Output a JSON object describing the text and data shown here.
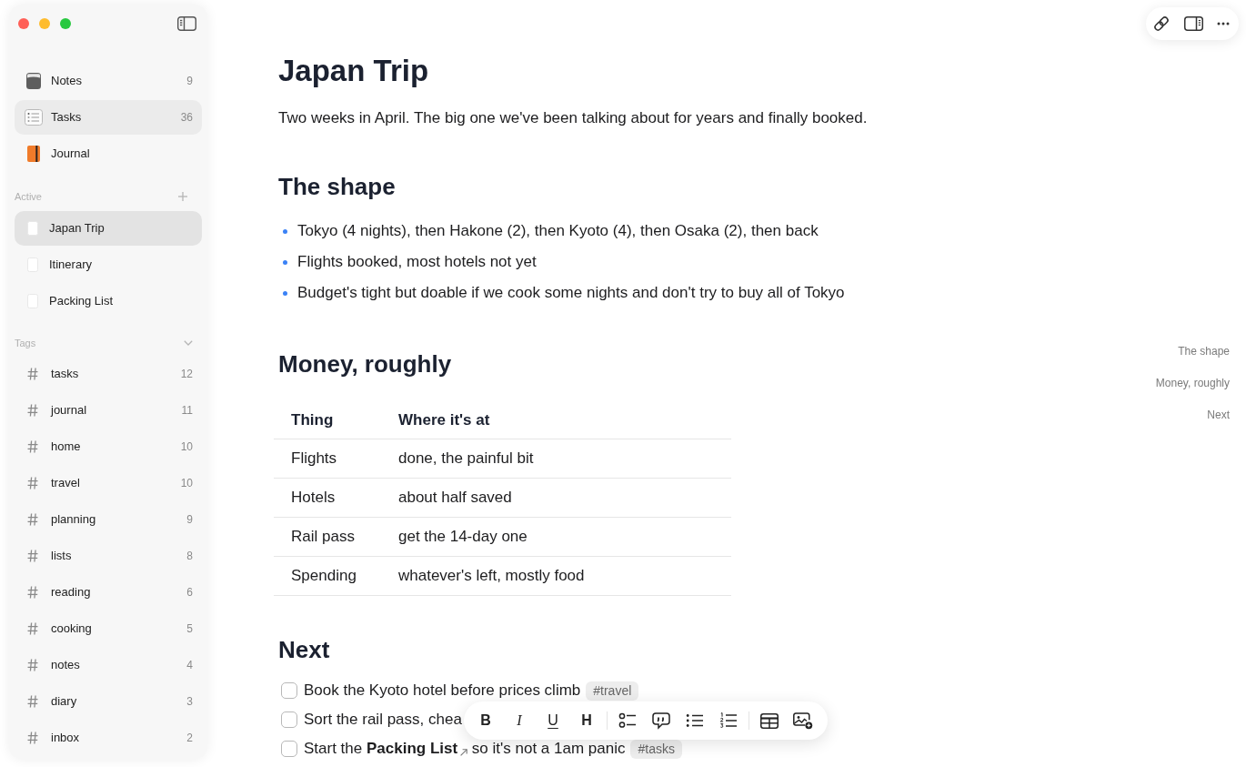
{
  "sidebar": {
    "libraries": [
      {
        "kind": "notes",
        "label": "Notes",
        "count": "9",
        "selected": false
      },
      {
        "kind": "tasks",
        "label": "Tasks",
        "count": "36",
        "selected": true
      },
      {
        "kind": "journal",
        "label": "Journal",
        "selected": false
      }
    ],
    "active": {
      "title": "Active",
      "items": [
        {
          "label": "Japan Trip",
          "selected": true
        },
        {
          "label": "Itinerary",
          "selected": false
        },
        {
          "label": "Packing List",
          "selected": false
        }
      ]
    },
    "tags": {
      "title": "Tags",
      "expanded": true,
      "items": [
        {
          "label": "tasks",
          "count": "12"
        },
        {
          "label": "journal",
          "count": "11"
        },
        {
          "label": "home",
          "count": "10"
        },
        {
          "label": "travel",
          "count": "10"
        },
        {
          "label": "planning",
          "count": "9"
        },
        {
          "label": "lists",
          "count": "8"
        },
        {
          "label": "reading",
          "count": "6"
        },
        {
          "label": "cooking",
          "count": "5"
        },
        {
          "label": "notes",
          "count": "4"
        },
        {
          "label": "diary",
          "count": "3"
        },
        {
          "label": "inbox",
          "count": "2"
        }
      ]
    }
  },
  "document": {
    "title": "Japan Trip",
    "blocks": [
      {
        "kind": "paragraph",
        "text": "Two weeks in April. The big one we've been talking about for years and finally booked."
      },
      {
        "kind": "heading",
        "text": "The shape"
      },
      {
        "kind": "bullets",
        "items": [
          "Tokyo (4 nights), then Hakone (2), then Kyoto (4), then Osaka (2), then back",
          "Flights booked, most hotels not yet",
          "Budget's tight but doable if we cook some nights and don't try to buy all of Tokyo"
        ]
      },
      {
        "kind": "heading",
        "text": "Money, roughly"
      },
      {
        "kind": "table",
        "columns": [
          "Thing",
          "Where it's at"
        ],
        "rows": [
          [
            "Flights",
            "done, the painful bit"
          ],
          [
            "Hotels",
            "about half saved"
          ],
          [
            "Rail pass",
            "get the 14-day one"
          ],
          [
            "Spending",
            "whatever's left, mostly food"
          ]
        ]
      },
      {
        "kind": "heading",
        "text": "Next"
      },
      {
        "kind": "tasks",
        "items": [
          {
            "checked": false,
            "segments": [
              {
                "kind": "text",
                "text": "Book the Kyoto hotel before prices climb"
              }
            ],
            "tag": "#travel"
          },
          {
            "checked": false,
            "segments": [
              {
                "kind": "text",
                "text": "Sort the rail pass, chea"
              }
            ]
          },
          {
            "checked": false,
            "segments": [
              {
                "kind": "text",
                "text": "Start the "
              },
              {
                "kind": "link",
                "text": "Packing List"
              },
              {
                "kind": "text",
                "text": " so it's not a 1am panic"
              }
            ],
            "tag": "#tasks"
          }
        ]
      }
    ]
  },
  "outline": [
    "The shape",
    "Money, roughly",
    "Next"
  ],
  "format_toolbar": {
    "groups": [
      [
        {
          "kind": "bold",
          "label": "B"
        },
        {
          "kind": "italic",
          "label": "I"
        },
        {
          "kind": "underline",
          "label": "U"
        },
        {
          "kind": "heading",
          "label": "H"
        }
      ],
      [
        {
          "kind": "checklist"
        },
        {
          "kind": "quote"
        },
        {
          "kind": "bullet_list"
        },
        {
          "kind": "numbered_list"
        }
      ],
      [
        {
          "kind": "table"
        },
        {
          "kind": "image"
        }
      ]
    ]
  }
}
